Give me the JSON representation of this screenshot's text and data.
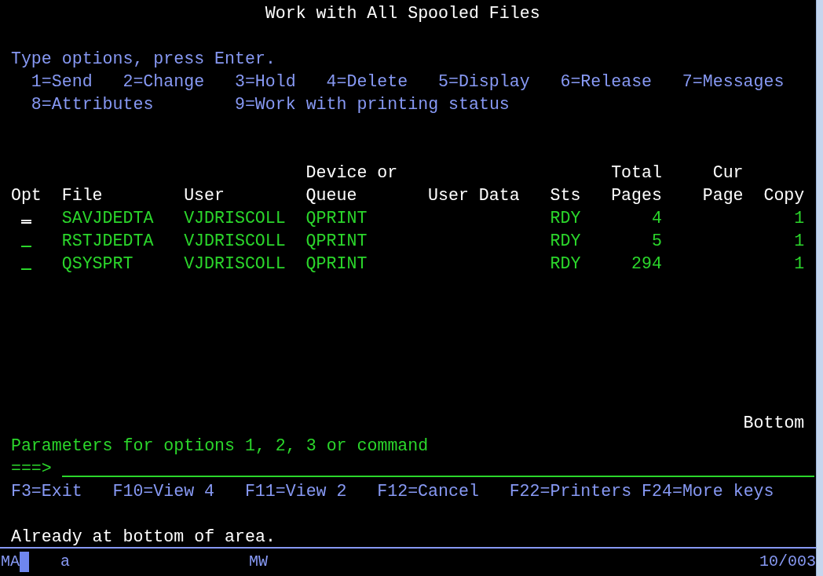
{
  "title": "Work with All Spooled Files",
  "instructions": "Type options, press Enter.",
  "option_lines": [
    [
      "1=Send",
      "2=Change",
      "3=Hold",
      "4=Delete",
      "5=Display",
      "6=Release",
      "7=Messages"
    ],
    [
      "8=Attributes",
      "9=Work with printing status"
    ]
  ],
  "columns": [
    {
      "label": "Opt"
    },
    {
      "label": "File"
    },
    {
      "label": "User"
    },
    {
      "top": "Device or",
      "label": "Queue"
    },
    {
      "label": "User Data"
    },
    {
      "label": "Sts"
    },
    {
      "top": "Total",
      "label": "Pages"
    },
    {
      "top": "Cur",
      "label": "Page"
    },
    {
      "label": "Copy"
    }
  ],
  "rows": [
    {
      "cursor": true,
      "cells": [
        "SAVJDEDTA",
        "VJDRISCOLL",
        "QPRINT",
        "",
        "RDY",
        "4",
        "",
        "1"
      ]
    },
    {
      "cursor": false,
      "cells": [
        "RSTJDEDTA",
        "VJDRISCOLL",
        "QPRINT",
        "",
        "RDY",
        "5",
        "",
        "1"
      ]
    },
    {
      "cursor": false,
      "cells": [
        "QSYSPRT",
        "VJDRISCOLL",
        "QPRINT",
        "",
        "RDY",
        "294",
        "",
        "1"
      ]
    }
  ],
  "position": "Bottom",
  "parameters_label": "Parameters for options 1, 2, 3 or command",
  "command_prompt": "===>",
  "function_keys": [
    "F3=Exit",
    "F10=View 4",
    "F11=View 2",
    "F12=Cancel",
    "F22=Printers",
    "F24=More keys"
  ],
  "message": "Already at bottom of area.",
  "status_bar": {
    "indicator": "MA",
    "items": [
      "a",
      "MW"
    ],
    "position": "10/003"
  }
}
